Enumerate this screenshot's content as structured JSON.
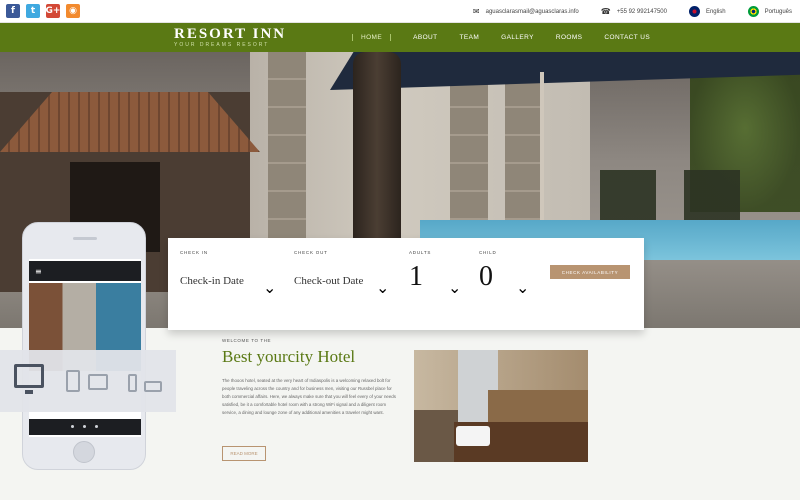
{
  "topbar": {
    "social": [
      {
        "name": "facebook-icon",
        "glyph": "f"
      },
      {
        "name": "twitter-icon",
        "glyph": "t"
      },
      {
        "name": "googleplus-icon",
        "glyph": "G+"
      },
      {
        "name": "rss-icon",
        "glyph": "◉"
      }
    ],
    "email": "aguasclarasmail@aguasclaras.info",
    "phone": "+55 92 992147500",
    "lang_en": "English",
    "lang_pt": "Português"
  },
  "nav": {
    "logo_name": "RESORT INN",
    "logo_tagline": "YOUR DREAMS RESORT",
    "items": [
      "HOME",
      "ABOUT",
      "TEAM",
      "GALLERY",
      "ROOMS",
      "CONTACT US"
    ],
    "active": "HOME"
  },
  "booking": {
    "check_in_label": "CHECK IN",
    "check_in_value": "Check-in Date",
    "check_out_label": "CHECK OUT",
    "check_out_value": "Check-out Date",
    "adults_label": "ADULTS",
    "adults_value": "1",
    "child_label": "CHILD",
    "child_value": "0",
    "button": "CHECK AVAILABILITY"
  },
  "content": {
    "welcome": "WELCOME TO THE",
    "title": "Best yourcity Hotel",
    "paragraph": "The Ihooos hotel, seated at the very heart of Indiaspolis is a welcoming relaxed bolt for people traveling across the country and for business men, visiting our Russbel place for both commercial affairs. Here, we always make sure that you will feel every of your needs satisfied, be it a comfortable hotel room with a strong WiFi signal and a diligent room service, a dining and lounge zone of any additional amenities a traveler might want.",
    "readmore": "READ MORE"
  },
  "colors": {
    "brand_green": "#5a7914",
    "accent_tan": "#b89471"
  }
}
